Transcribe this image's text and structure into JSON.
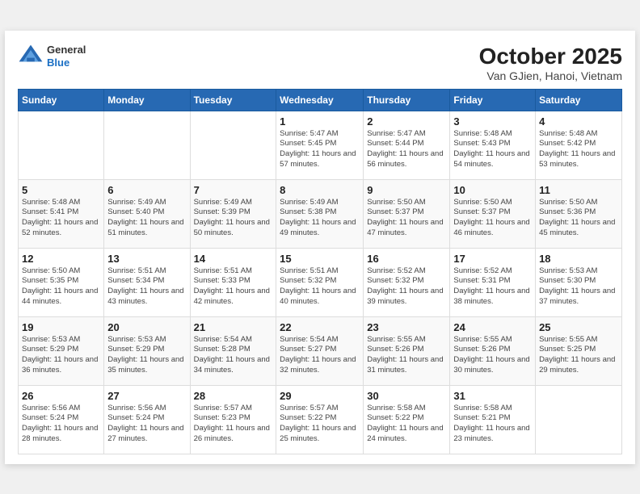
{
  "header": {
    "logo_general": "General",
    "logo_blue": "Blue",
    "title": "October 2025",
    "subtitle": "Van GJien, Hanoi, Vietnam"
  },
  "weekdays": [
    "Sunday",
    "Monday",
    "Tuesday",
    "Wednesday",
    "Thursday",
    "Friday",
    "Saturday"
  ],
  "weeks": [
    [
      {
        "day": "",
        "info": ""
      },
      {
        "day": "",
        "info": ""
      },
      {
        "day": "",
        "info": ""
      },
      {
        "day": "1",
        "info": "Sunrise: 5:47 AM\nSunset: 5:45 PM\nDaylight: 11 hours\nand 57 minutes."
      },
      {
        "day": "2",
        "info": "Sunrise: 5:47 AM\nSunset: 5:44 PM\nDaylight: 11 hours\nand 56 minutes."
      },
      {
        "day": "3",
        "info": "Sunrise: 5:48 AM\nSunset: 5:43 PM\nDaylight: 11 hours\nand 54 minutes."
      },
      {
        "day": "4",
        "info": "Sunrise: 5:48 AM\nSunset: 5:42 PM\nDaylight: 11 hours\nand 53 minutes."
      }
    ],
    [
      {
        "day": "5",
        "info": "Sunrise: 5:48 AM\nSunset: 5:41 PM\nDaylight: 11 hours\nand 52 minutes."
      },
      {
        "day": "6",
        "info": "Sunrise: 5:49 AM\nSunset: 5:40 PM\nDaylight: 11 hours\nand 51 minutes."
      },
      {
        "day": "7",
        "info": "Sunrise: 5:49 AM\nSunset: 5:39 PM\nDaylight: 11 hours\nand 50 minutes."
      },
      {
        "day": "8",
        "info": "Sunrise: 5:49 AM\nSunset: 5:38 PM\nDaylight: 11 hours\nand 49 minutes."
      },
      {
        "day": "9",
        "info": "Sunrise: 5:50 AM\nSunset: 5:37 PM\nDaylight: 11 hours\nand 47 minutes."
      },
      {
        "day": "10",
        "info": "Sunrise: 5:50 AM\nSunset: 5:37 PM\nDaylight: 11 hours\nand 46 minutes."
      },
      {
        "day": "11",
        "info": "Sunrise: 5:50 AM\nSunset: 5:36 PM\nDaylight: 11 hours\nand 45 minutes."
      }
    ],
    [
      {
        "day": "12",
        "info": "Sunrise: 5:50 AM\nSunset: 5:35 PM\nDaylight: 11 hours\nand 44 minutes."
      },
      {
        "day": "13",
        "info": "Sunrise: 5:51 AM\nSunset: 5:34 PM\nDaylight: 11 hours\nand 43 minutes."
      },
      {
        "day": "14",
        "info": "Sunrise: 5:51 AM\nSunset: 5:33 PM\nDaylight: 11 hours\nand 42 minutes."
      },
      {
        "day": "15",
        "info": "Sunrise: 5:51 AM\nSunset: 5:32 PM\nDaylight: 11 hours\nand 40 minutes."
      },
      {
        "day": "16",
        "info": "Sunrise: 5:52 AM\nSunset: 5:32 PM\nDaylight: 11 hours\nand 39 minutes."
      },
      {
        "day": "17",
        "info": "Sunrise: 5:52 AM\nSunset: 5:31 PM\nDaylight: 11 hours\nand 38 minutes."
      },
      {
        "day": "18",
        "info": "Sunrise: 5:53 AM\nSunset: 5:30 PM\nDaylight: 11 hours\nand 37 minutes."
      }
    ],
    [
      {
        "day": "19",
        "info": "Sunrise: 5:53 AM\nSunset: 5:29 PM\nDaylight: 11 hours\nand 36 minutes."
      },
      {
        "day": "20",
        "info": "Sunrise: 5:53 AM\nSunset: 5:29 PM\nDaylight: 11 hours\nand 35 minutes."
      },
      {
        "day": "21",
        "info": "Sunrise: 5:54 AM\nSunset: 5:28 PM\nDaylight: 11 hours\nand 34 minutes."
      },
      {
        "day": "22",
        "info": "Sunrise: 5:54 AM\nSunset: 5:27 PM\nDaylight: 11 hours\nand 32 minutes."
      },
      {
        "day": "23",
        "info": "Sunrise: 5:55 AM\nSunset: 5:26 PM\nDaylight: 11 hours\nand 31 minutes."
      },
      {
        "day": "24",
        "info": "Sunrise: 5:55 AM\nSunset: 5:26 PM\nDaylight: 11 hours\nand 30 minutes."
      },
      {
        "day": "25",
        "info": "Sunrise: 5:55 AM\nSunset: 5:25 PM\nDaylight: 11 hours\nand 29 minutes."
      }
    ],
    [
      {
        "day": "26",
        "info": "Sunrise: 5:56 AM\nSunset: 5:24 PM\nDaylight: 11 hours\nand 28 minutes."
      },
      {
        "day": "27",
        "info": "Sunrise: 5:56 AM\nSunset: 5:24 PM\nDaylight: 11 hours\nand 27 minutes."
      },
      {
        "day": "28",
        "info": "Sunrise: 5:57 AM\nSunset: 5:23 PM\nDaylight: 11 hours\nand 26 minutes."
      },
      {
        "day": "29",
        "info": "Sunrise: 5:57 AM\nSunset: 5:22 PM\nDaylight: 11 hours\nand 25 minutes."
      },
      {
        "day": "30",
        "info": "Sunrise: 5:58 AM\nSunset: 5:22 PM\nDaylight: 11 hours\nand 24 minutes."
      },
      {
        "day": "31",
        "info": "Sunrise: 5:58 AM\nSunset: 5:21 PM\nDaylight: 11 hours\nand 23 minutes."
      },
      {
        "day": "",
        "info": ""
      }
    ]
  ]
}
